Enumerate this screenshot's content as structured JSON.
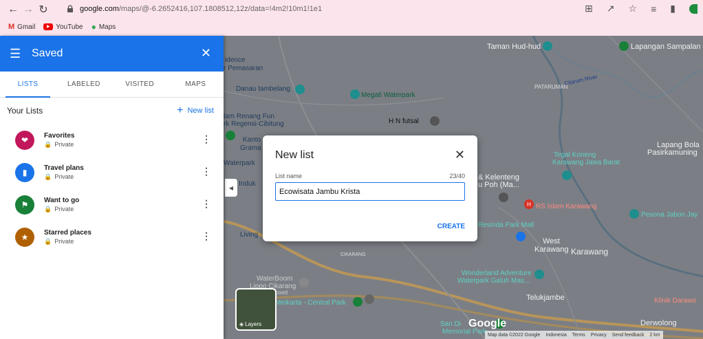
{
  "browser": {
    "url_domain": "google.com",
    "url_path": "/maps/@-6.2652416,107.1808512,12z/data=!4m2!10m1!1e1",
    "bookmarks": [
      {
        "label": "Gmail",
        "icon": "gmail-icon"
      },
      {
        "label": "YouTube",
        "icon": "youtube-icon"
      },
      {
        "label": "Maps",
        "icon": "maps-icon"
      }
    ]
  },
  "sidebar": {
    "title": "Saved",
    "tabs": [
      {
        "label": "LISTS"
      },
      {
        "label": "LABELED"
      },
      {
        "label": "VISITED"
      },
      {
        "label": "MAPS"
      }
    ],
    "section_title": "Your Lists",
    "new_list_label": "New list",
    "lists": [
      {
        "name": "Favorites",
        "privacy": "Private",
        "color": "#c2185b",
        "icon": "heart-icon"
      },
      {
        "name": "Travel plans",
        "privacy": "Private",
        "color": "#1a73e8",
        "icon": "suitcase-icon"
      },
      {
        "name": "Want to go",
        "privacy": "Private",
        "color": "#188038",
        "icon": "flag-icon"
      },
      {
        "name": "Starred places",
        "privacy": "Private",
        "color": "#b06000",
        "icon": "star-icon"
      }
    ]
  },
  "dialog": {
    "title": "New list",
    "field_label": "List name",
    "char_count": "23/40",
    "value": "Ecowisata Jambu Krista",
    "create_label": "CREATE"
  },
  "map": {
    "labels": {
      "idence": "idence",
      "pemasaran": "r Pemasaran",
      "danau": "Danau tambelang",
      "megati": "Megati Waterpark",
      "renang1": "lam Renang Fun",
      "renang2": "rk Regensi-Cibitung",
      "hn_futsal": "H N futsal",
      "kanto": "Kanto",
      "grama": "Grama",
      "waterpark": "Waterpark",
      "induk": "r Induk",
      "living": "Living",
      "taman": "Taman Hud-hud",
      "lapangan_samp": "Lapangan Sampalan",
      "citarum": "Citarum River",
      "pataruman": "PATARUMAN",
      "lapangan_bola1": "Lapang Bola",
      "lapangan_bola2": "Pasirkamuning",
      "tegal1": "Tegal Koneng",
      "tegal2": "Karawang Jawa Barat",
      "kelenteng1": "& Kelenteng",
      "kelenteng2": "u Poh (Ma...",
      "rs_islam": "RS Islam Karawang",
      "pesona": "Pesona Jabon Jay",
      "resinda": "Resinda Park Mall",
      "west1": "West",
      "west2": "Karawang",
      "karawang": "Karawang",
      "cikarang": "CIKARANG",
      "wonderland1": "Wonderland Adventure",
      "wonderland2": "Waterpark Galuh Mas...",
      "waterboom1": "WaterBoom",
      "waterboom2": "Lippo Cikarang",
      "closed": "closed",
      "meikarta": "Meikarta - Central Park",
      "telukjambe": "Telukjambe",
      "klinik": "Klinik Darawo",
      "derwolong": "Derwolong",
      "san_di": "San Di",
      "memorial": "Memorial Park"
    },
    "layers_label": "Layers",
    "logo_text": "Google",
    "attribution": [
      "Map data ©2022 Google",
      "Indonesia",
      "Terms",
      "Privacy",
      "Send feedback",
      "2 km"
    ]
  },
  "colors": {
    "accent": "#1a73e8",
    "header": "#1a73e8",
    "chrome": "#fce4ec"
  }
}
